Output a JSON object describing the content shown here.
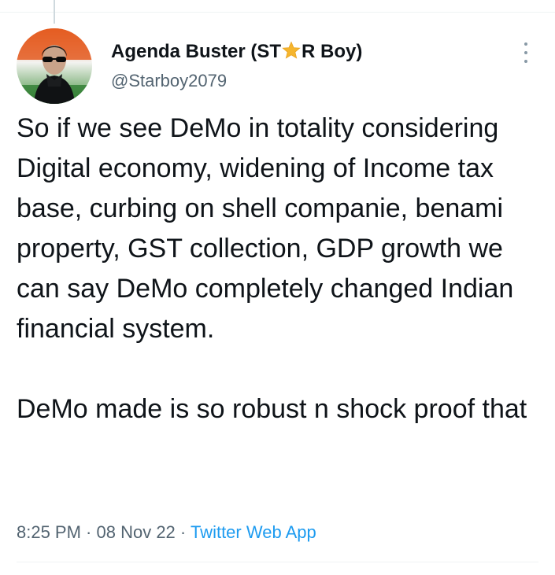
{
  "author": {
    "name_prefix": "Agenda Buster (ST",
    "name_suffix": "R Boy)",
    "name_emoji_icon": "star-icon",
    "handle": "@Starboy2079",
    "avatar_icon": "profile-avatar"
  },
  "tweet": {
    "paragraph_1": "So if we see DeMo in totality considering Digital economy, widening of Income tax base, curbing on shell companie, benami property, GST collection, GDP growth we can say DeMo completely changed Indian financial system.",
    "paragraph_2": "DeMo made is so robust n shock proof that"
  },
  "meta": {
    "time": "8:25 PM",
    "separator": " · ",
    "date": "08 Nov 22",
    "source": "Twitter Web App"
  },
  "colors": {
    "text": "#0f1419",
    "secondary": "#536471",
    "link": "#1d9bf0",
    "divider": "#eff3f4"
  },
  "icons": {
    "more": "more-vertical-icon"
  }
}
